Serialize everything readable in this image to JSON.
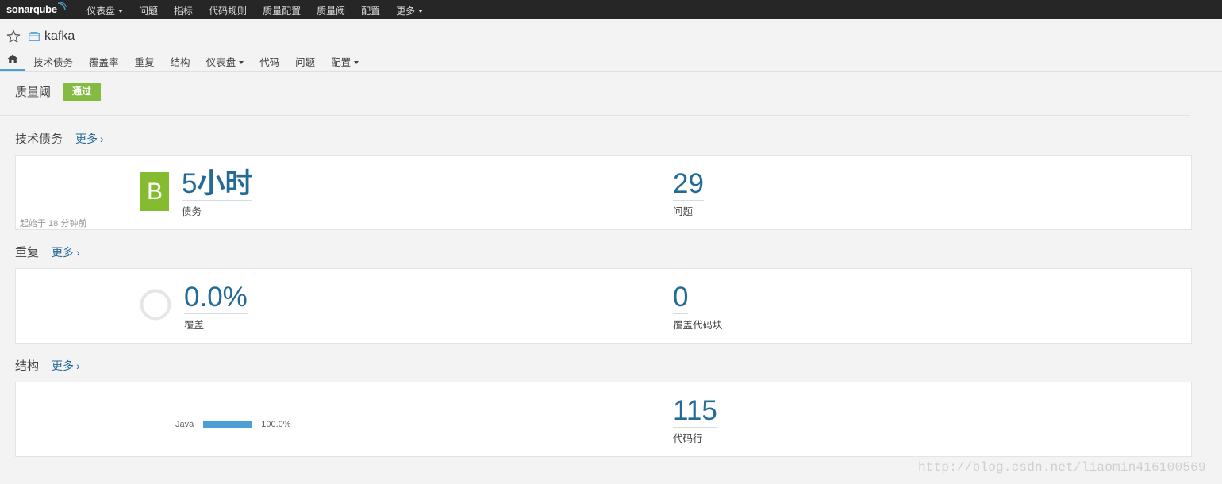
{
  "topnav": {
    "logo": "sonarqube",
    "menu": [
      {
        "label": "仪表盘",
        "dropdown": true
      },
      {
        "label": "问题",
        "dropdown": false
      },
      {
        "label": "指标",
        "dropdown": false
      },
      {
        "label": "代码规则",
        "dropdown": false
      },
      {
        "label": "质量配置",
        "dropdown": false
      },
      {
        "label": "质量阈",
        "dropdown": false
      },
      {
        "label": "配置",
        "dropdown": false
      },
      {
        "label": "更多",
        "dropdown": true
      }
    ]
  },
  "project": {
    "name": "kafka",
    "favorite_icon": "star-icon",
    "type_icon": "project-icon"
  },
  "project_nav": {
    "home_icon": "home-icon",
    "tabs": [
      "技术债务",
      "覆盖率",
      "重复",
      "结构",
      "仪表盘",
      "代码",
      "问题",
      "配置"
    ]
  },
  "quality_gate": {
    "label": "质量阈",
    "status": "通过",
    "status_color": "#85bb43"
  },
  "tech_debt": {
    "title": "技术债务",
    "more": "更多",
    "rating": "B",
    "rating_color": "#85bb2f",
    "since": "起始于 18 分钟前",
    "debt_num": "5",
    "debt_unit": "小时",
    "debt_label": "债务",
    "issues_value": "29",
    "issues_label": "问题"
  },
  "duplications": {
    "title": "重复",
    "more": "更多",
    "density_value": "0.0%",
    "density_label": "覆盖",
    "blocks_value": "0",
    "blocks_label": "覆盖代码块"
  },
  "structure": {
    "title": "结构",
    "more": "更多",
    "language": "Java",
    "language_percent": "100.0%",
    "lines_value": "115",
    "lines_label": "代码行"
  },
  "watermark": "http://blog.csdn.net/liaomin416100569",
  "colors": {
    "accent": "#236a97",
    "bar": "#4b9fd5",
    "topbar": "#262626"
  }
}
